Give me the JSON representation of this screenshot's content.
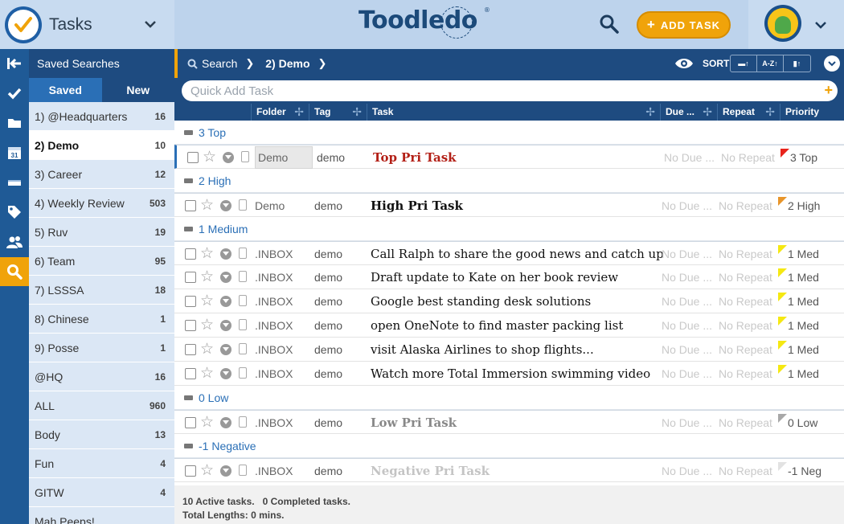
{
  "app": {
    "title": "Tasks",
    "brand": "Toodledo",
    "brand_mark": "®"
  },
  "header": {
    "add_task_label": "ADD TASK"
  },
  "nav": {
    "icons": [
      "collapse-icon",
      "check-icon",
      "folder-icon",
      "calendar-icon",
      "context-icon",
      "tag-icon",
      "people-icon",
      "search-icon"
    ],
    "calendar_day": "31"
  },
  "saved_searches": {
    "title": "Saved Searches",
    "tabs": [
      "Saved",
      "New"
    ],
    "items": [
      {
        "name": "1) @Headquarters",
        "count": "16"
      },
      {
        "name": "2) Demo",
        "count": "10"
      },
      {
        "name": "3) Career",
        "count": "12"
      },
      {
        "name": "4) Weekly Review",
        "count": "503"
      },
      {
        "name": "5) Ruv",
        "count": "19"
      },
      {
        "name": "6) Team",
        "count": "95"
      },
      {
        "name": "7) LSSSA",
        "count": "18"
      },
      {
        "name": "8) Chinese",
        "count": "1"
      },
      {
        "name": "9) Posse",
        "count": "1"
      },
      {
        "name": "@HQ",
        "count": "16"
      },
      {
        "name": "ALL",
        "count": "960"
      },
      {
        "name": "Body",
        "count": "13"
      },
      {
        "name": "Fun",
        "count": "4"
      },
      {
        "name": "GITW",
        "count": "4"
      },
      {
        "name": "Mah Peeps!",
        "count": ""
      }
    ]
  },
  "toolbar": {
    "crumb_search": "Search",
    "crumb_current": "2) Demo",
    "sort_label": "SORT",
    "sort_buttons": [
      "▬↑",
      "A-Z↑",
      "▮↑"
    ]
  },
  "quick_add": {
    "placeholder": "Quick Add Task"
  },
  "columns": {
    "folder": "Folder",
    "tag": "Tag",
    "task": "Task",
    "due": "Due ...",
    "repeat": "Repeat",
    "priority": "Priority"
  },
  "groups": [
    {
      "label": "3 Top",
      "tasks": [
        {
          "folder": "Demo",
          "tag": "demo",
          "title": "Top Pri Task",
          "due": "No Due ...",
          "repeat": "No Repeat",
          "priority": "3 Top",
          "flag_color": "#e8231b",
          "style": "bold red"
        }
      ]
    },
    {
      "label": "2 High",
      "tasks": [
        {
          "folder": "Demo",
          "tag": "demo",
          "title": "High Pri Task",
          "due": "No Due ...",
          "repeat": "No Repeat",
          "priority": "2 High",
          "flag_color": "#e8952a",
          "style": "bold"
        }
      ]
    },
    {
      "label": "1 Medium",
      "tasks": [
        {
          "folder": ".INBOX",
          "tag": "demo",
          "title": "Call Ralph to share the good news and catch up",
          "due": "No Due ...",
          "repeat": "No Repeat",
          "priority": "1 Med",
          "flag_color": "#f5e812",
          "style": ""
        },
        {
          "folder": ".INBOX",
          "tag": "demo",
          "title": "Draft update to Kate on her book review",
          "due": "No Due ...",
          "repeat": "No Repeat",
          "priority": "1 Med",
          "flag_color": "#f5e812",
          "style": ""
        },
        {
          "folder": ".INBOX",
          "tag": "demo",
          "title": "Google best standing desk solutions",
          "due": "No Due ...",
          "repeat": "No Repeat",
          "priority": "1 Med",
          "flag_color": "#f5e812",
          "style": ""
        },
        {
          "folder": ".INBOX",
          "tag": "demo",
          "title": "open OneNote to find master packing list",
          "due": "No Due ...",
          "repeat": "No Repeat",
          "priority": "1 Med",
          "flag_color": "#f5e812",
          "style": ""
        },
        {
          "folder": ".INBOX",
          "tag": "demo",
          "title": "visit Alaska Airlines to shop flights...",
          "due": "No Due ...",
          "repeat": "No Repeat",
          "priority": "1 Med",
          "flag_color": "#f5e812",
          "style": ""
        },
        {
          "folder": ".INBOX",
          "tag": "demo",
          "title": "Watch more Total Immersion swimming video",
          "due": "No Due ...",
          "repeat": "No Repeat",
          "priority": "1 Med",
          "flag_color": "#f5e812",
          "style": ""
        }
      ]
    },
    {
      "label": "0 Low",
      "tasks": [
        {
          "folder": ".INBOX",
          "tag": "demo",
          "title": "Low Pri Task",
          "due": "No Due ...",
          "repeat": "No Repeat",
          "priority": "0 Low",
          "flag_color": "#a8a8a8",
          "style": "bold grey"
        }
      ]
    },
    {
      "label": "-1 Negative",
      "tasks": [
        {
          "folder": ".INBOX",
          "tag": "demo",
          "title": "Negative Pri Task",
          "due": "No Due ...",
          "repeat": "No Repeat",
          "priority": "-1 Neg",
          "flag_color": "#e2e2e2",
          "style": "bold lgrey"
        }
      ]
    }
  ],
  "footer": {
    "summary": "10 Active tasks.   0 Completed tasks.",
    "lengths": "Total Lengths: 0 mins."
  },
  "colors": {
    "accent": "#f0a30a",
    "nav_dark": "#1e4b80",
    "link_blue": "#2a6fb6"
  }
}
